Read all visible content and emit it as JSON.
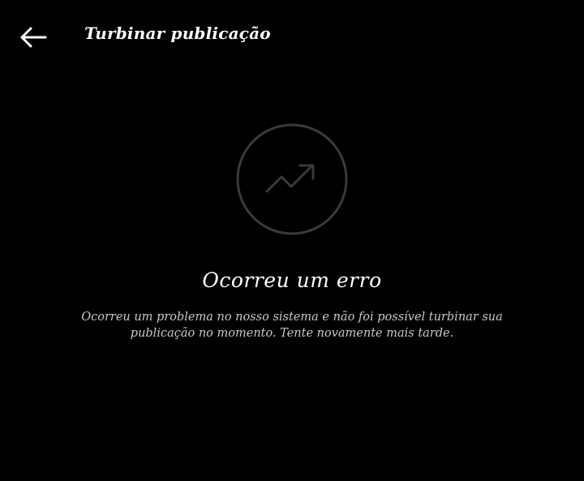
{
  "header": {
    "title": "Turbinar publicação",
    "back_icon": "arrow-left-icon"
  },
  "state": {
    "icon": "trending-up-icon",
    "heading": "Ocorreu um erro",
    "message": "Ocorreu um problema no nosso sistema e não foi possível turbinar sua publicação no momento. Tente novamente mais tarde."
  },
  "colors": {
    "background": "#000000",
    "text_primary": "#ffffff",
    "text_secondary": "#c8c8c8",
    "icon_stroke": "#3a3a3a"
  }
}
